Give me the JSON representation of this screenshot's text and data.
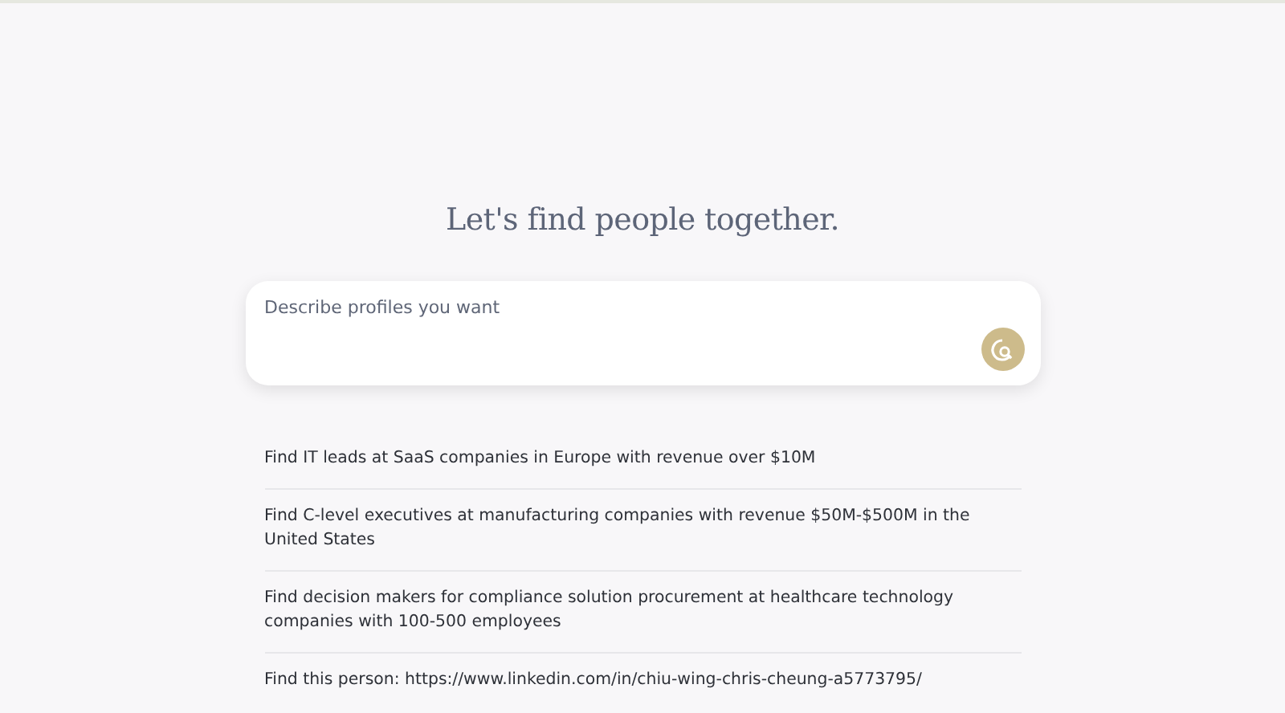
{
  "heading": "Let's find people together.",
  "search": {
    "placeholder": "Describe profiles you want"
  },
  "suggestions": [
    {
      "text": "Find IT leads at SaaS companies in Europe with revenue over $10M"
    },
    {
      "text": "Find C-level executives at manufacturing companies with revenue $50M-$500M in the United States"
    },
    {
      "text": "Find decision makers for compliance solution procurement at healthcare technology companies with 100-500 employees"
    },
    {
      "text": "Find this person: https://www.linkedin.com/in/chiu-wing-chris-cheung-a5773795/"
    }
  ]
}
